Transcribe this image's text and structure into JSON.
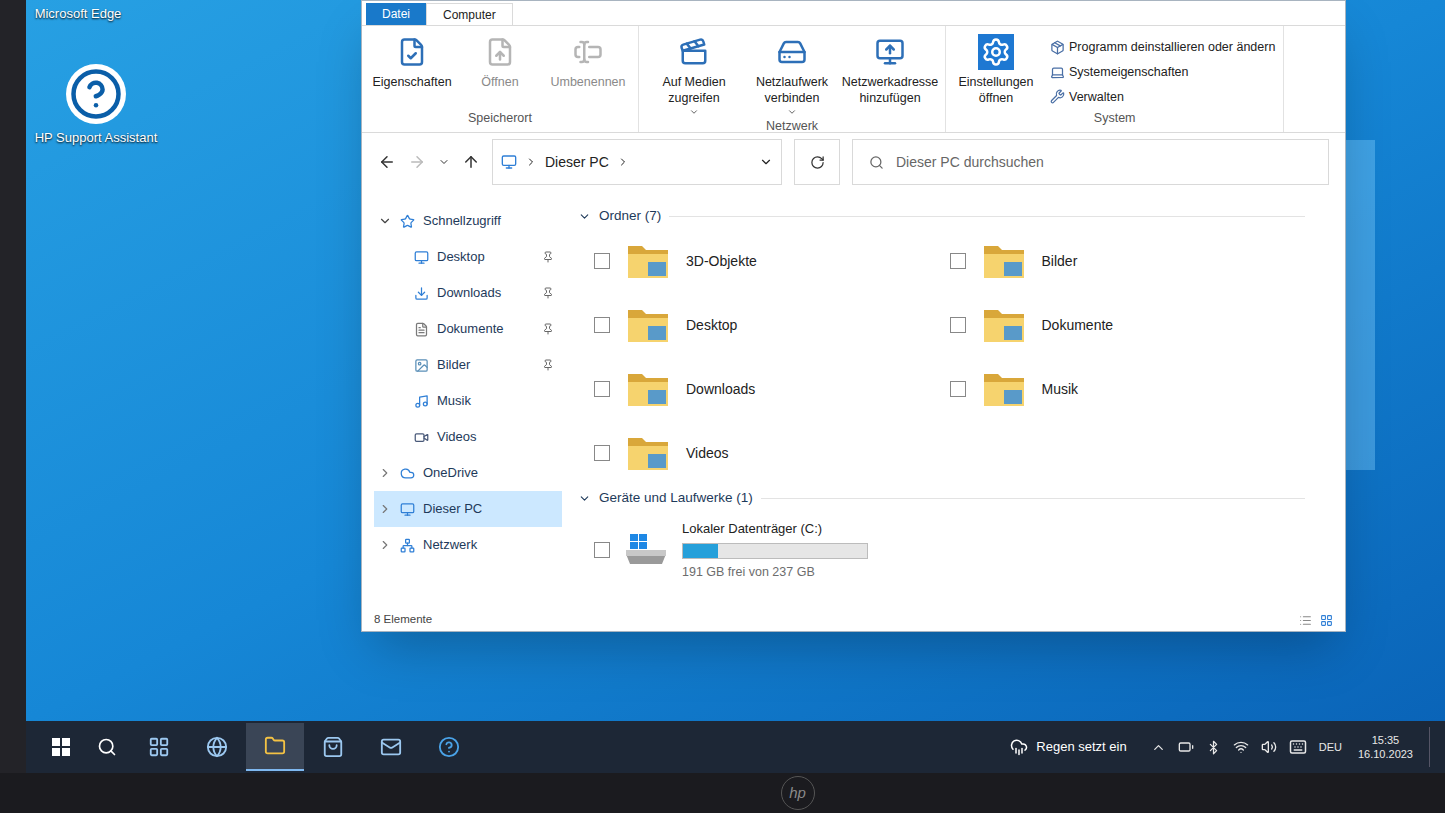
{
  "desktop_icons": [
    {
      "label": "Microsoft Edge"
    },
    {
      "label": "HP Support Assistant"
    }
  ],
  "window": {
    "ribbon_tabs": [
      {
        "label": "Datei",
        "selected": false
      },
      {
        "label": "Computer",
        "selected": true
      }
    ],
    "ribbon_groups": [
      {
        "label": "Speicherort",
        "buttons": [
          {
            "label": "Eigenschaften",
            "disabled": false,
            "dropdown": false
          },
          {
            "label": "Öffnen",
            "disabled": true,
            "dropdown": false
          },
          {
            "label": "Umbenennen",
            "disabled": true,
            "dropdown": false
          }
        ],
        "small_buttons": []
      },
      {
        "label": "Netzwerk",
        "buttons": [
          {
            "label": "Auf Medien zugreifen",
            "disabled": false,
            "dropdown": true
          },
          {
            "label": "Netzlaufwerk verbinden",
            "disabled": false,
            "dropdown": true
          },
          {
            "label": "Netzwerkadresse hinzufügen",
            "disabled": false,
            "dropdown": false
          }
        ],
        "small_buttons": []
      },
      {
        "label": "System",
        "buttons": [
          {
            "label": "Einstellungen öffnen",
            "disabled": false,
            "dropdown": false
          }
        ],
        "small_buttons": [
          {
            "label": "Programm deinstallieren oder ändern"
          },
          {
            "label": "Systemeigenschaften"
          },
          {
            "label": "Verwalten"
          }
        ]
      }
    ],
    "address": {
      "path": "Dieser PC"
    },
    "search": {
      "placeholder": "Dieser PC durchsuchen"
    },
    "nav_items": [
      {
        "label": "Schnellzugriff",
        "kind": "root",
        "expanded": true,
        "pinned": false,
        "selected": false
      },
      {
        "label": "Desktop",
        "kind": "child",
        "expanded": false,
        "pinned": true,
        "selected": false
      },
      {
        "label": "Downloads",
        "kind": "child",
        "expanded": false,
        "pinned": true,
        "selected": false
      },
      {
        "label": "Dokumente",
        "kind": "child",
        "expanded": false,
        "pinned": true,
        "selected": false
      },
      {
        "label": "Bilder",
        "kind": "child",
        "expanded": false,
        "pinned": true,
        "selected": false
      },
      {
        "label": "Musik",
        "kind": "child",
        "expanded": false,
        "pinned": false,
        "selected": false
      },
      {
        "label": "Videos",
        "kind": "child",
        "expanded": false,
        "pinned": false,
        "selected": false
      },
      {
        "label": "OneDrive",
        "kind": "root",
        "expanded": false,
        "pinned": false,
        "selected": false
      },
      {
        "label": "Dieser PC",
        "kind": "root",
        "expanded": false,
        "pinned": false,
        "selected": true
      },
      {
        "label": "Netzwerk",
        "kind": "root",
        "expanded": false,
        "pinned": false,
        "selected": false
      }
    ],
    "folders_section": {
      "title": "Ordner (7)",
      "expanded": true
    },
    "folders": [
      {
        "label": "3D-Objekte",
        "checked": false
      },
      {
        "label": "Bilder",
        "checked": false
      },
      {
        "label": "Desktop",
        "checked": false
      },
      {
        "label": "Dokumente",
        "checked": false
      },
      {
        "label": "Downloads",
        "checked": false
      },
      {
        "label": "Musik",
        "checked": false
      },
      {
        "label": "Videos",
        "checked": false
      }
    ],
    "drives_section": {
      "title": "Geräte und Laufwerke (1)",
      "expanded": true
    },
    "drives": [
      {
        "label": "Lokaler Datenträger (C:)",
        "checked": false,
        "level": 0.19,
        "reading": "191 GB frei von 237 GB"
      }
    ],
    "status_bar": {
      "text": "8 Elemente"
    }
  },
  "taskbar": {
    "weather": "Regen setzt ein",
    "language": "DEU",
    "time": "15:35",
    "date": "16.10.2023",
    "apps": [
      {
        "selected": false
      },
      {
        "selected": false
      },
      {
        "selected": true
      },
      {
        "selected": false
      },
      {
        "selected": false
      },
      {
        "selected": false
      }
    ]
  },
  "bezel": {
    "logo": "hp"
  }
}
